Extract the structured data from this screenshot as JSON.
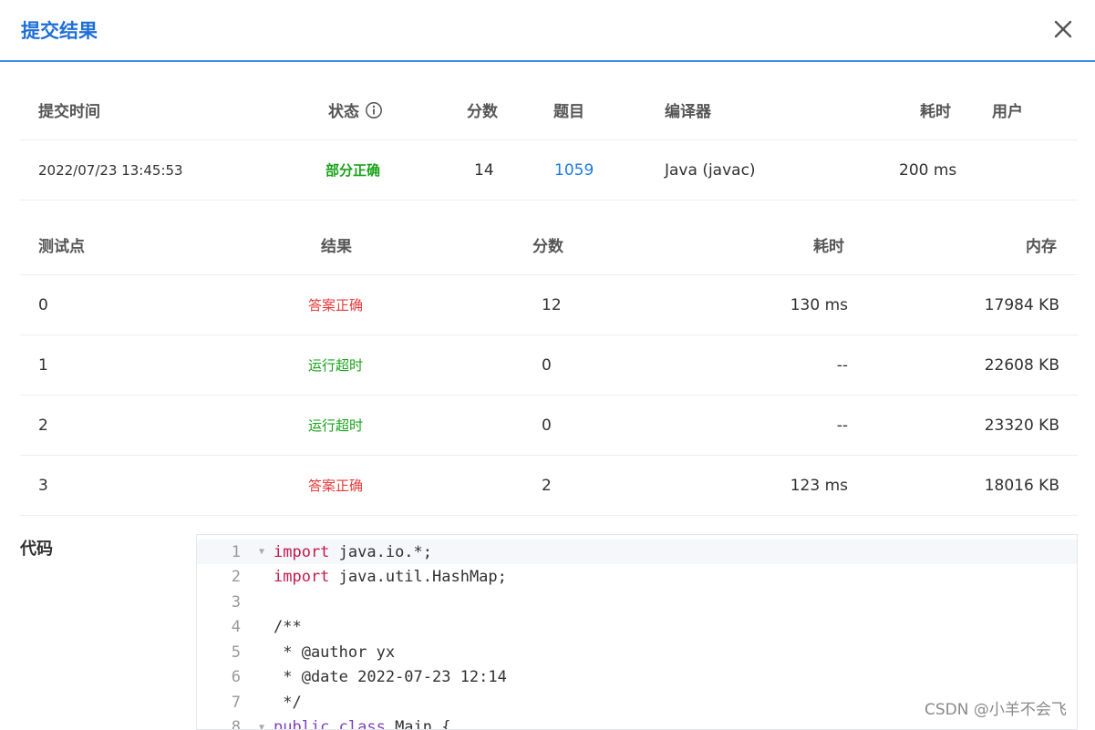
{
  "dialog": {
    "title": "提交结果"
  },
  "submission": {
    "headers": {
      "time": "提交时间",
      "status": "状态",
      "score": "分数",
      "problem": "题目",
      "compiler": "编译器",
      "elapsed": "耗时",
      "user": "用户"
    },
    "row": {
      "time": "2022/07/23 13:45:53",
      "status": "部分正确",
      "score": "14",
      "problem": "1059",
      "compiler": "Java (javac)",
      "elapsed": "200 ms",
      "user": ""
    }
  },
  "testcases": {
    "headers": {
      "id": "测试点",
      "result": "结果",
      "score": "分数",
      "elapsed": "耗时",
      "memory": "内存"
    },
    "rows": [
      {
        "id": "0",
        "result": "答案正确",
        "result_color": "#e53b3b",
        "score": "12",
        "elapsed": "130 ms",
        "memory": "17984 KB"
      },
      {
        "id": "1",
        "result": "运行超时",
        "result_color": "#19a319",
        "score": "0",
        "elapsed": "--",
        "memory": "22608 KB"
      },
      {
        "id": "2",
        "result": "运行超时",
        "result_color": "#19a319",
        "score": "0",
        "elapsed": "--",
        "memory": "23320 KB"
      },
      {
        "id": "3",
        "result": "答案正确",
        "result_color": "#e53b3b",
        "score": "2",
        "elapsed": "123 ms",
        "memory": "18016 KB"
      }
    ]
  },
  "code": {
    "label": "代码",
    "lines": [
      {
        "n": "1",
        "kw": "import",
        "rest": " java.io.*;"
      },
      {
        "n": "2",
        "kw": "import",
        "rest": " java.util.HashMap;"
      },
      {
        "n": "3",
        "kw": "",
        "rest": ""
      },
      {
        "n": "4",
        "kw": "",
        "rest": "/**"
      },
      {
        "n": "5",
        "kw": "",
        "rest": " * @author yx"
      },
      {
        "n": "6",
        "kw": "",
        "rest": " * @date 2022-07-23 12:14"
      },
      {
        "n": "7",
        "kw": "",
        "rest": " */"
      },
      {
        "n": "8",
        "kw": "public class",
        "rest": " Main {"
      }
    ]
  },
  "watermark": "CSDN @小羊不会飞",
  "icons": {
    "close": "close-icon",
    "info": "info-icon",
    "fold": "fold-arrow-icon"
  },
  "colors": {
    "accent": "#1f6fd6",
    "success": "#19a319",
    "error": "#e53b3b",
    "link": "#1f7be0"
  }
}
